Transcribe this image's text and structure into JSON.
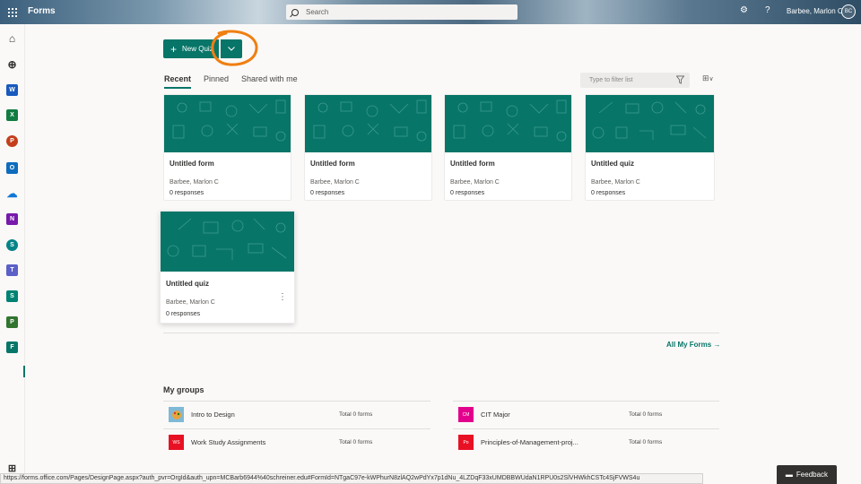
{
  "header": {
    "app_name": "Forms",
    "search_placeholder": "Search",
    "settings_icon": "gear-icon",
    "help_icon": "question-icon",
    "user_name": "Barbee, Marlon C",
    "user_initials": "BC"
  },
  "toolbar": {
    "new_label": "New Quiz",
    "dropdown_icon": "chevron-down-icon"
  },
  "tabs": [
    {
      "label": "Recent",
      "active": true
    },
    {
      "label": "Pinned",
      "active": false
    },
    {
      "label": "Shared with me",
      "active": false
    }
  ],
  "filter": {
    "placeholder": "Type to filter list"
  },
  "cards": [
    {
      "title": "Untitled form",
      "owner": "Barbee, Marlon C",
      "responses": "0 responses"
    },
    {
      "title": "Untitled form",
      "owner": "Barbee, Marlon C",
      "responses": "0 responses"
    },
    {
      "title": "Untitled form",
      "owner": "Barbee, Marlon C",
      "responses": "0 responses"
    },
    {
      "title": "Untitled quiz",
      "owner": "Barbee, Marlon C",
      "responses": "0 responses"
    },
    {
      "title": "Untitled quiz",
      "owner": "Barbee, Marlon C",
      "responses": "0 responses"
    }
  ],
  "all_link": "All My Forms →",
  "groups": {
    "title": "My groups",
    "items": [
      {
        "name": "Intro to Design",
        "count": "Total 0 forms",
        "initials": "",
        "color": "#7fb9d6"
      },
      {
        "name": "Work Study Assignments",
        "count": "Total 0 forms",
        "initials": "WS",
        "color": "#e81123"
      },
      {
        "name": "CIT Major",
        "count": "Total 0 forms",
        "initials": "CM",
        "color": "#e3008c"
      },
      {
        "name": "Principles-of-Management-proj...",
        "count": "Total 0 forms",
        "initials": "Po",
        "color": "#e81123"
      }
    ]
  },
  "status_url": "https://forms.office.com/Pages/DesignPage.aspx?auth_pvr=OrgId&auth_upn=MCBarb6944%40schreiner.edu#FormId=NTgaC97e-kWPhurN8zlAQ2wPdYx7p1dNu_4LZDqF33xUMDBBWUdaN1RPU0s2SlVHWkhCSTc4SjFVWS4u",
  "feedback_label": "Feedback",
  "rail": [
    {
      "icon": "home-icon",
      "label": "⌂"
    },
    {
      "icon": "add-app-icon",
      "label": "⊕"
    },
    {
      "icon": "word-icon",
      "label": "W",
      "color": "#185abd"
    },
    {
      "icon": "excel-icon",
      "label": "X",
      "color": "#107c41"
    },
    {
      "icon": "powerpoint-icon",
      "label": "P",
      "color": "#c43e1c"
    },
    {
      "icon": "outlook-icon",
      "label": "O",
      "color": "#0f6cbd"
    },
    {
      "icon": "onedrive-icon",
      "label": "☁",
      "color": "#0f78d4"
    },
    {
      "icon": "onenote-icon",
      "label": "N",
      "color": "#7719aa"
    },
    {
      "icon": "sharepoint-icon",
      "label": "S",
      "color": "#038387"
    },
    {
      "icon": "teams-icon",
      "label": "T",
      "color": "#5b5fc7"
    },
    {
      "icon": "sway-icon",
      "label": "S",
      "color": "#008272"
    },
    {
      "icon": "planner-icon",
      "label": "P",
      "color": "#31752f"
    },
    {
      "icon": "forms-icon",
      "label": "F",
      "color": "#077568"
    }
  ]
}
